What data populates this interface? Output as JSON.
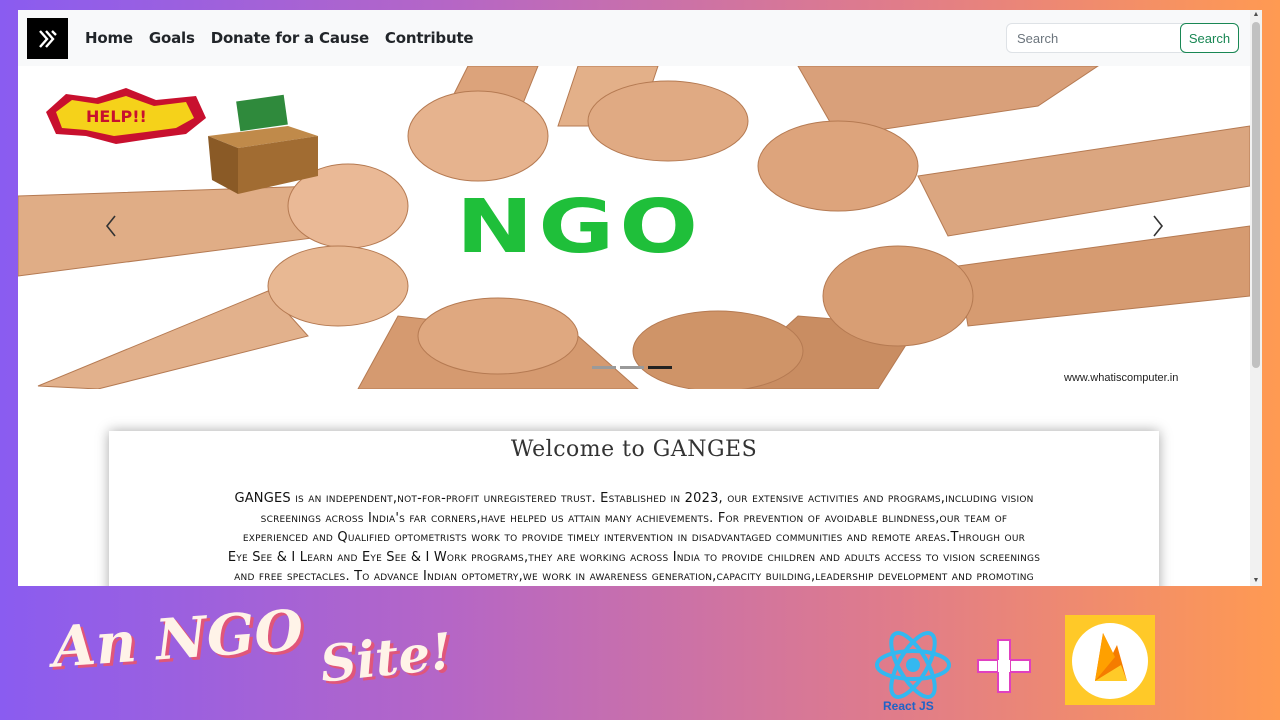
{
  "navbar": {
    "links": [
      "Home",
      "Goals",
      "Donate for a Cause",
      "Contribute"
    ],
    "search_placeholder": "Search",
    "search_button": "Search"
  },
  "carousel": {
    "headline": "NGO",
    "sticker_text": "HELP!!",
    "watermark": "www.whatiscomputer.in",
    "slide_count": 3,
    "active_slide": 3
  },
  "welcome": {
    "title": "Welcome to GANGES",
    "lines": [
      "GANGES is an independent,not-for-profit unregistered trust. Established in 2023, our extensive activities and programs,including vision",
      "screenings across India's far corners,have helped us attain many achievements. For prevention of avoidable blindness,our team of",
      "experienced and Qualified optometrists work to provide timely intervention in disadvantaged communities and remote areas.Through our",
      "Eye See & I Learn and Eye See & I Work programs,they are working across India to provide children and adults access to vision screenings",
      "and free spectacles. To advance Indian optometry,we work in awareness generation,capacity building,leadership development and promoting"
    ]
  },
  "promo": {
    "title_part1": "An NGO",
    "title_part2": "Site!",
    "react_label": "React JS"
  },
  "colors": {
    "ngo_green": "#1fbf3a",
    "search_green": "#198754",
    "firebase_yellow": "#ffc928",
    "react_blue": "#33b8f0"
  }
}
